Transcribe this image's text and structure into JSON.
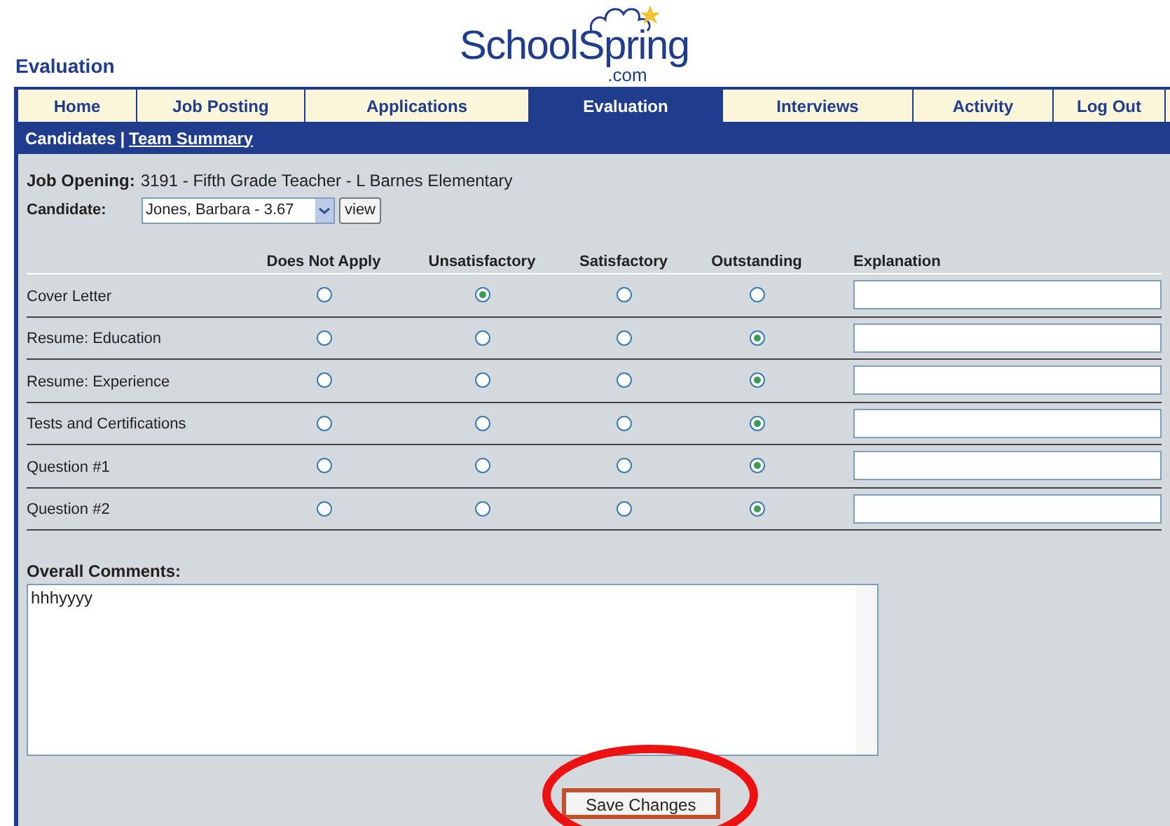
{
  "page_title": "Evaluation",
  "logo": {
    "name": "SchoolSpring",
    "suffix": ".com"
  },
  "tabs": [
    {
      "label": "Home",
      "selected": false
    },
    {
      "label": "Job Posting",
      "selected": false
    },
    {
      "label": "Applications",
      "selected": false
    },
    {
      "label": "Evaluation",
      "selected": true
    },
    {
      "label": "Interviews",
      "selected": false
    },
    {
      "label": "Activity",
      "selected": false
    },
    {
      "label": "Log Out",
      "selected": false
    }
  ],
  "subnav": {
    "current": "Candidates",
    "separator": "|",
    "link": "Team Summary"
  },
  "job_opening": {
    "label": "Job Opening:",
    "value": "3191 - Fifth Grade Teacher - L Barnes Elementary"
  },
  "candidate": {
    "label": "Candidate:",
    "value": "Jones, Barbara - 3.67",
    "button": "view"
  },
  "columns": [
    "Does Not Apply",
    "Unsatisfactory",
    "Satisfactory",
    "Outstanding",
    "Explanation"
  ],
  "criteria": [
    {
      "name": "Cover Letter",
      "options": [
        {
          "selected": false
        },
        {
          "selected": true
        },
        {
          "selected": false
        },
        {
          "selected": false
        }
      ]
    },
    {
      "name": "Resume: Education",
      "options": [
        {
          "selected": false
        },
        {
          "selected": false
        },
        {
          "selected": false
        },
        {
          "selected": true
        }
      ]
    },
    {
      "name": "Resume: Experience",
      "options": [
        {
          "selected": false
        },
        {
          "selected": false
        },
        {
          "selected": false
        },
        {
          "selected": true
        }
      ]
    },
    {
      "name": "Tests and Certifications",
      "options": [
        {
          "selected": false
        },
        {
          "selected": false
        },
        {
          "selected": false
        },
        {
          "selected": true
        }
      ]
    },
    {
      "name": "Question #1",
      "options": [
        {
          "selected": false
        },
        {
          "selected": false
        },
        {
          "selected": false
        },
        {
          "selected": true
        }
      ]
    },
    {
      "name": "Question #2",
      "options": [
        {
          "selected": false
        },
        {
          "selected": false
        },
        {
          "selected": false
        },
        {
          "selected": true
        }
      ]
    }
  ],
  "comments": {
    "label": "Overall Comments:",
    "value": "hhhyyyy"
  },
  "save_button": "Save Changes",
  "highlight": true
}
